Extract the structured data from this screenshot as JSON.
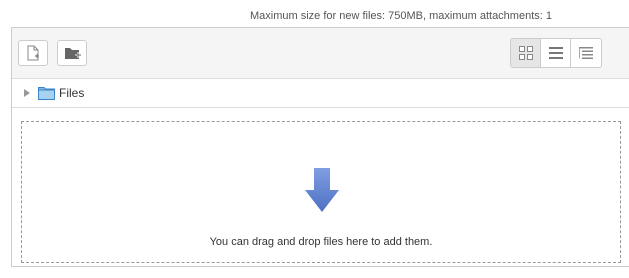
{
  "limits": {
    "text": "Maximum size for new files: 750MB, maximum attachments: 1"
  },
  "toolbar": {
    "add_icon": "add-file-icon",
    "create_folder_icon": "create-folder-icon",
    "views": [
      {
        "name": "icons-view",
        "icon": "grid-icon",
        "active": true
      },
      {
        "name": "list-view",
        "icon": "list-icon",
        "active": false
      },
      {
        "name": "tree-view",
        "icon": "tree-icon",
        "active": false
      }
    ]
  },
  "path": {
    "label": "Files"
  },
  "dropzone": {
    "message": "You can drag and drop files here to add them."
  },
  "colors": {
    "arrow": "#6b8fd6",
    "folder": "#7ab8e8",
    "border": "#cccccc"
  }
}
